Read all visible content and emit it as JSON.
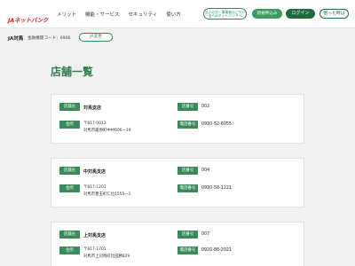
{
  "header": {
    "logo_text": "JAネットバンク",
    "nav": [
      "メリット",
      "機能・サービス",
      "セキュリティ",
      "使い方"
    ],
    "corp_button_line1": "法人の方・事業者はこちら",
    "corp_button_line2": "法人JAネットバンクへ",
    "new_button": "新規申込み",
    "login_button": "ログイン",
    "help_button": "困った時は"
  },
  "subbar": {
    "bank_name": "JA対馬",
    "bank_code": "金融機関コード：6906",
    "change_button": "JA変更"
  },
  "page_title": "店舗一覧",
  "stores": [
    {
      "name_label": "店舗名",
      "name": "対馬支店",
      "number_label": "店番号",
      "number": "002",
      "address_label": "住所",
      "postal": "〒817-0013",
      "address": "対馬市厳原町中村606—19",
      "phone_label": "電話番号",
      "phone": "0920-52-6055"
    },
    {
      "name_label": "店舗名",
      "name": "中対馬支店",
      "number_label": "店番号",
      "number": "004",
      "address_label": "住所",
      "postal": "〒817-1201",
      "address": "対馬市豊玉町仁位1555—2",
      "phone_label": "電話番号",
      "phone": "0920-58-1221"
    },
    {
      "name_label": "店舗名",
      "name": "上対馬支店",
      "number_label": "店番号",
      "number": "007",
      "address_label": "住所",
      "postal": "〒817-1701",
      "address": "対馬市上対馬町比田勝829",
      "phone_label": "電話番号",
      "phone": "0920-86-2021"
    }
  ],
  "colors": {
    "brand_green": "#2e7d4a",
    "tag_green": "#3a8a5a",
    "login_green": "#1f6b3d",
    "logo_red": "#d7262e",
    "background": "#f2f2f2"
  }
}
